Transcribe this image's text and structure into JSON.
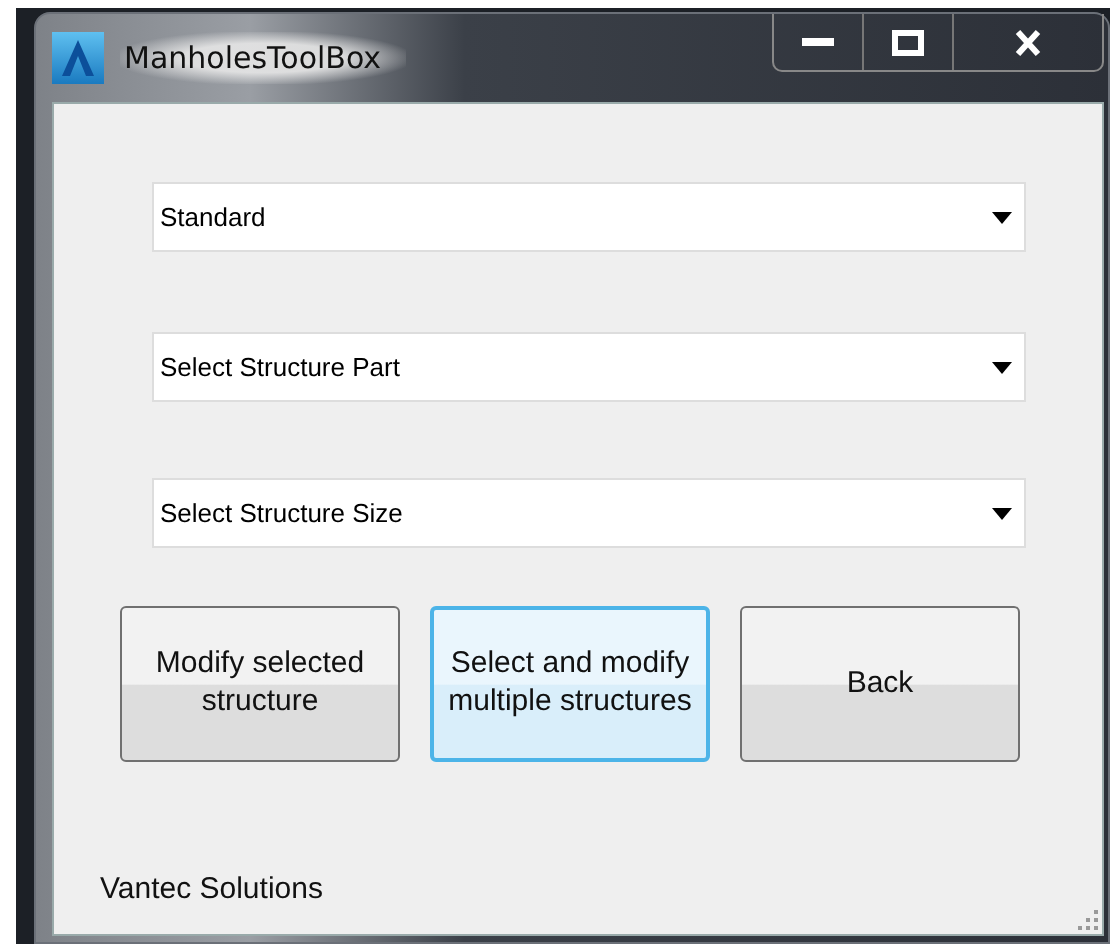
{
  "window": {
    "title": "ManholesToolBox"
  },
  "dropdowns": [
    {
      "value": "Standard"
    },
    {
      "value": "Select Structure Part"
    },
    {
      "value": "Select Structure Size"
    }
  ],
  "buttons": [
    {
      "label": "Modify selected structure",
      "focused": false
    },
    {
      "label": "Select and modify multiple structures",
      "focused": true
    },
    {
      "label": "Back",
      "focused": false
    }
  ],
  "footer": {
    "text": "Vantec Solutions"
  }
}
